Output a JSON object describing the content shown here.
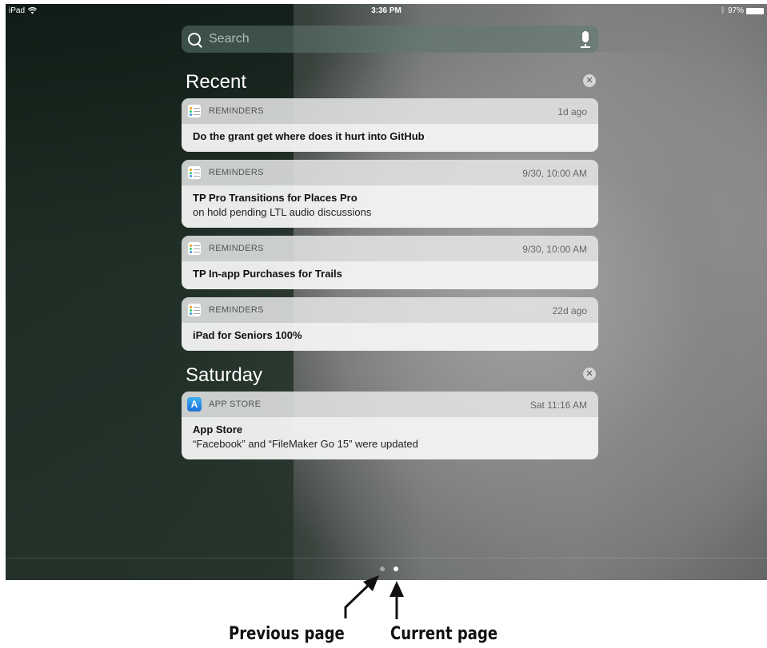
{
  "status_bar": {
    "device": "iPad",
    "time": "3:36 PM",
    "battery": "97%"
  },
  "search": {
    "placeholder": "Search"
  },
  "sections": [
    {
      "title": "Recent"
    },
    {
      "title": "Saturday"
    }
  ],
  "notifications": [
    {
      "app": "REMINDERS",
      "time": "1d ago",
      "title": "Do the grant  get where does it hurt into GitHub",
      "body": ""
    },
    {
      "app": "REMINDERS",
      "time": "9/30, 10:00 AM",
      "title": "TP Pro Transitions for Places Pro",
      "body": "on hold pending LTL audio discussions"
    },
    {
      "app": "REMINDERS",
      "time": "9/30, 10:00 AM",
      "title": "TP In-app Purchases for Trails",
      "body": ""
    },
    {
      "app": "REMINDERS",
      "time": "22d ago",
      "title": "iPad for Seniors 100%",
      "body": ""
    },
    {
      "app": "APP STORE",
      "time": "Sat 11:16 AM",
      "title": "App Store",
      "body": "“Facebook” and “FileMaker Go 15” were updated"
    }
  ],
  "icons": {
    "reminders": "reminders-app-icon",
    "app_store": "app-store-icon",
    "search": "search-icon",
    "mic": "mic-icon",
    "clear": "close-icon",
    "wifi": "wifi-icon",
    "bluetooth": "bluetooth-icon",
    "battery": "battery-icon"
  },
  "pagination": {
    "total": 2,
    "current": 2
  },
  "annotations": {
    "previous": "Previous page",
    "current": "Current page"
  }
}
